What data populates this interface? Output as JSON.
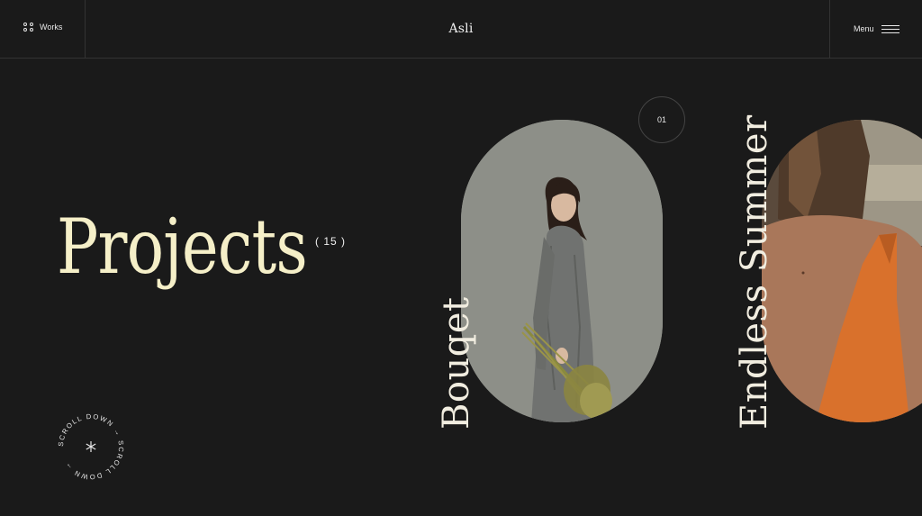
{
  "header": {
    "works_label": "Works",
    "logo": "Asli",
    "menu_label": "Menu"
  },
  "hero": {
    "title": "Projects",
    "count": "( 15 )"
  },
  "scroll_badge": {
    "text": "SCROLL DOWN → SCROLL DOWN →",
    "center_icon": "asterisk-icon"
  },
  "slider": {
    "current_index": "01",
    "items": [
      {
        "title": "Bouqet",
        "image_icon": "woman-with-bouquet-photo"
      },
      {
        "title": "Endless Summer",
        "image_icon": "woman-orange-dress-photo"
      }
    ]
  },
  "colors": {
    "background": "#1a1a1a",
    "title_cream": "#f5efc8",
    "pill_grey": "#8d8f88",
    "dress_orange": "#d9712c"
  }
}
